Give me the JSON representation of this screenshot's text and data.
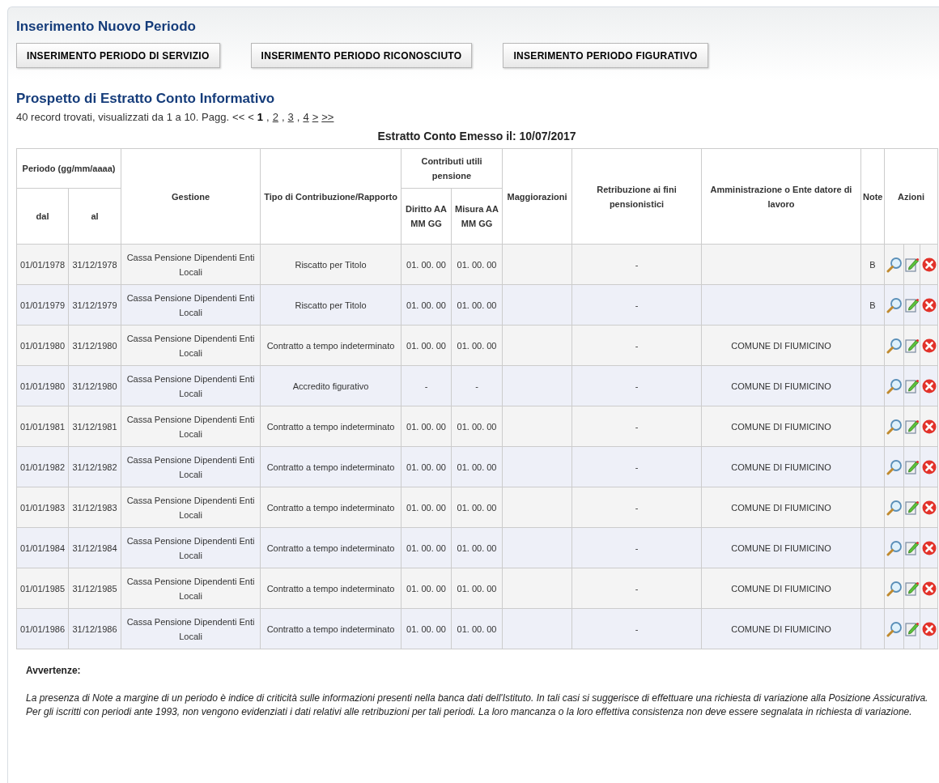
{
  "section_title": "Inserimento Nuovo Periodo",
  "buttons": [
    "INSERIMENTO PERIODO DI SERVIZIO",
    "INSERIMENTO PERIODO RICONOSCIUTO",
    "INSERIMENTO PERIODO FIGURATIVO"
  ],
  "table_title": "Prospetto di Estratto Conto Informativo",
  "pagination": {
    "summary": "40 record trovati, visualizzati da 1 a 10. Pagg.",
    "separator": ",",
    "items": [
      {
        "kind": "nav",
        "label": "<<",
        "disabled": true
      },
      {
        "kind": "nav",
        "label": "<",
        "disabled": true
      },
      {
        "kind": "page",
        "label": "1",
        "selected": true
      },
      {
        "kind": "page",
        "label": "2",
        "selected": false
      },
      {
        "kind": "page",
        "label": "3",
        "selected": false
      },
      {
        "kind": "page",
        "label": "4",
        "selected": false
      },
      {
        "kind": "nav",
        "label": ">",
        "disabled": false
      },
      {
        "kind": "nav",
        "label": ">>",
        "disabled": false
      }
    ]
  },
  "statement_date": "Estratto Conto Emesso il: 10/07/2017",
  "table": {
    "headers": {
      "periodo": "Periodo (gg/mm/aaaa)",
      "dal": "dal",
      "al": "al",
      "gestione": "Gestione",
      "tipo": "Tipo di Contribuzione/Rapporto",
      "contributi": "Contributi utili pensione",
      "diritto": "Diritto AA MM GG",
      "misura": "Misura AA MM GG",
      "maggiorazioni": "Maggiorazioni",
      "retribuzione": "Retribuzione ai fini pensionistici",
      "amministrazione": "Amministrazione o Ente datore di lavoro",
      "note": "Note",
      "azioni": "Azioni"
    },
    "rows": [
      {
        "dal": "01/01/1978",
        "al": "31/12/1978",
        "gestione": "Cassa Pensione Dipendenti Enti Locali",
        "tipo": "Riscatto per Titolo",
        "diritto": "01. 00. 00",
        "misura": "01. 00. 00",
        "retribuzione": "-",
        "note": "B"
      },
      {
        "dal": "01/01/1979",
        "al": "31/12/1979",
        "gestione": "Cassa Pensione Dipendenti Enti Locali",
        "tipo": "Riscatto per Titolo",
        "diritto": "01. 00. 00",
        "misura": "01. 00. 00",
        "retribuzione": "-",
        "note": "B"
      },
      {
        "dal": "01/01/1980",
        "al": "31/12/1980",
        "gestione": "Cassa Pensione Dipendenti Enti Locali",
        "tipo": "Contratto a tempo indeterminato",
        "diritto": "01. 00. 00",
        "misura": "01. 00. 00",
        "retribuzione": "-",
        "amministrazione": "COMUNE DI FIUMICINO"
      },
      {
        "dal": "01/01/1980",
        "al": "31/12/1980",
        "gestione": "Cassa Pensione Dipendenti Enti Locali",
        "tipo": "Accredito figurativo",
        "diritto": "-",
        "misura": "-",
        "retribuzione": "-",
        "amministrazione": "COMUNE DI FIUMICINO"
      },
      {
        "dal": "01/01/1981",
        "al": "31/12/1981",
        "gestione": "Cassa Pensione Dipendenti Enti Locali",
        "tipo": "Contratto a tempo indeterminato",
        "diritto": "01. 00. 00",
        "misura": "01. 00. 00",
        "retribuzione": "-",
        "amministrazione": "COMUNE DI FIUMICINO"
      },
      {
        "dal": "01/01/1982",
        "al": "31/12/1982",
        "gestione": "Cassa Pensione Dipendenti Enti Locali",
        "tipo": "Contratto a tempo indeterminato",
        "diritto": "01. 00. 00",
        "misura": "01. 00. 00",
        "retribuzione": "-",
        "amministrazione": "COMUNE DI FIUMICINO"
      },
      {
        "dal": "01/01/1983",
        "al": "31/12/1983",
        "gestione": "Cassa Pensione Dipendenti Enti Locali",
        "tipo": "Contratto a tempo indeterminato",
        "diritto": "01. 00. 00",
        "misura": "01. 00. 00",
        "retribuzione": "-",
        "amministrazione": "COMUNE DI FIUMICINO"
      },
      {
        "dal": "01/01/1984",
        "al": "31/12/1984",
        "gestione": "Cassa Pensione Dipendenti Enti Locali",
        "tipo": "Contratto a tempo indeterminato",
        "diritto": "01. 00. 00",
        "misura": "01. 00. 00",
        "retribuzione": "-",
        "amministrazione": "COMUNE DI FIUMICINO"
      },
      {
        "dal": "01/01/1985",
        "al": "31/12/1985",
        "gestione": "Cassa Pensione Dipendenti Enti Locali",
        "tipo": "Contratto a tempo indeterminato",
        "diritto": "01. 00. 00",
        "misura": "01. 00. 00",
        "retribuzione": "-",
        "amministrazione": "COMUNE DI FIUMICINO"
      },
      {
        "dal": "01/01/1986",
        "al": "31/12/1986",
        "gestione": "Cassa Pensione Dipendenti Enti Locali",
        "tipo": "Contratto a tempo indeterminato",
        "diritto": "01. 00. 00",
        "misura": "01. 00. 00",
        "retribuzione": "-",
        "amministrazione": "COMUNE DI FIUMICINO"
      }
    ]
  },
  "warnings": {
    "title": "Avvertenze:",
    "paragraphs": [
      "La presenza di Note a margine di un periodo è indice di criticità sulle informazioni presenti nella banca dati dell'Istituto. In tali casi si suggerisce di effettuare una richiesta di variazione alla Posizione Assicurativa.",
      "Per gli iscritti con periodi ante 1993, non vengono evidenziati i dati relativi alle retribuzioni per tali periodi. La loro mancanza o la loro effettiva consistenza non deve essere segnalata in richiesta di variazione."
    ]
  }
}
